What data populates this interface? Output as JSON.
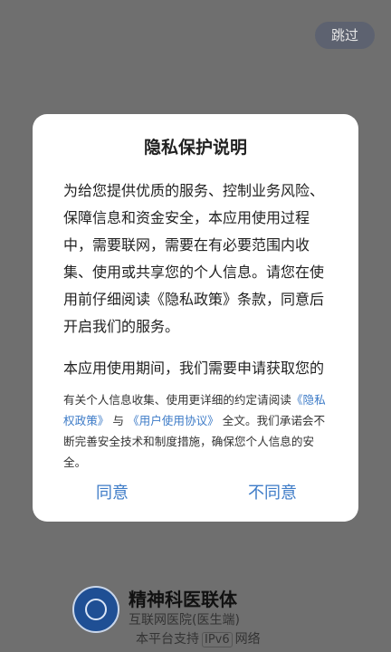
{
  "skip_label": "跳过",
  "dialog": {
    "title": "隐私保护说明",
    "paragraphs": [
      "为给您提供优质的服务、控制业务风险、保障信息和资金安全，本应用使用过程中，需要联网，需要在有必要范围内收集、使用或共享您的个人信息。请您在使用前仔细阅读《隐私政策》条款，同意后开启我们的服务。",
      "本应用使用期间，我们需要申请获取您的系统权限，我们将在首次调用时逐项"
    ],
    "note_before": "有关个人信息收集、使用更详细的约定请阅读",
    "link_privacy": "《隐私权政策》",
    "note_and": "与",
    "link_terms": "《用户使用协议》",
    "note_after": "全文。我们承诺会不断完善安全技术和制度措施，确保您个人信息的安全。",
    "agree_label": "同意",
    "disagree_label": "不同意"
  },
  "footer": {
    "title": "精神科医联体",
    "subtitle": "互联网医院(医生端)",
    "ipv6_prefix": "本平台支持",
    "ipv6_badge": "IPv6",
    "ipv6_suffix": "网络"
  }
}
